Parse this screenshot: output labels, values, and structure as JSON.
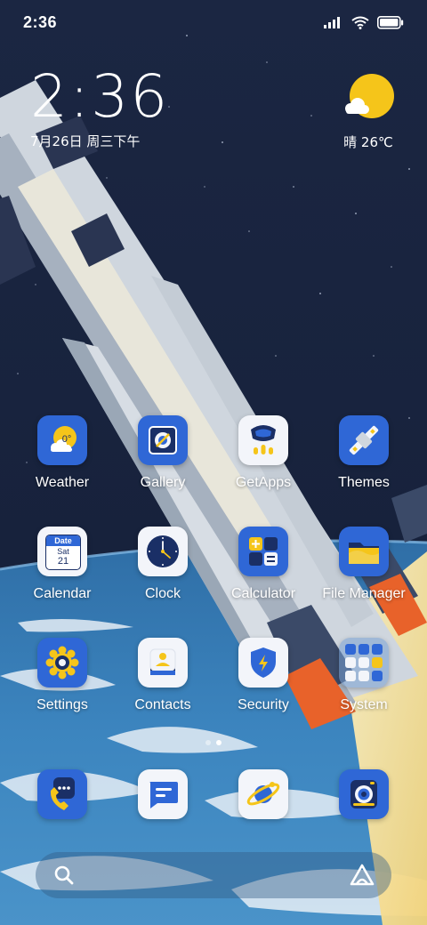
{
  "status_bar": {
    "time": "2:36",
    "icons": [
      "signal-icon",
      "wifi-icon",
      "battery-icon"
    ]
  },
  "clock_widget": {
    "time": "2:36",
    "date": "7月26日 周三下午"
  },
  "weather_widget": {
    "icon": "sun-cloud-icon",
    "text": "晴 26℃"
  },
  "apps": {
    "weather": {
      "label": "Weather",
      "icon": "weather-icon",
      "badge": "0°"
    },
    "gallery": {
      "label": "Gallery",
      "icon": "gallery-icon"
    },
    "getapps": {
      "label": "GetApps",
      "icon": "getapps-icon"
    },
    "themes": {
      "label": "Themes",
      "icon": "satellite-icon"
    },
    "calendar": {
      "label": "Calendar",
      "icon": "calendar-icon",
      "header": "Date",
      "weekday": "Sat",
      "day": "21"
    },
    "clock": {
      "label": "Clock",
      "icon": "clock-icon"
    },
    "calculator": {
      "label": "Calculator",
      "icon": "calculator-icon"
    },
    "file_manager": {
      "label": "File Manager",
      "icon": "folder-icon"
    },
    "settings": {
      "label": "Settings",
      "icon": "gear-icon"
    },
    "contacts": {
      "label": "Contacts",
      "icon": "contacts-icon"
    },
    "security": {
      "label": "Security",
      "icon": "shield-icon"
    },
    "system": {
      "label": "System",
      "icon": "folder-grid-icon"
    }
  },
  "dock": [
    {
      "name": "phone",
      "icon": "phone-icon"
    },
    {
      "name": "messages",
      "icon": "messages-icon"
    },
    {
      "name": "browser",
      "icon": "planet-icon"
    },
    {
      "name": "camera",
      "icon": "camera-icon"
    }
  ],
  "page_indicator": {
    "pages": 2,
    "active": 2
  },
  "search_bar": {
    "icon": "search-icon",
    "assistant_icon": "assistant-icon"
  },
  "colors": {
    "sky": "#15203a",
    "earth_blue": "#3a7fb8",
    "tile_blue": "#2f67d6",
    "tile_white": "#f3f5fa",
    "accent_yellow": "#f5c51a",
    "rocket_orange": "#e8622a"
  }
}
